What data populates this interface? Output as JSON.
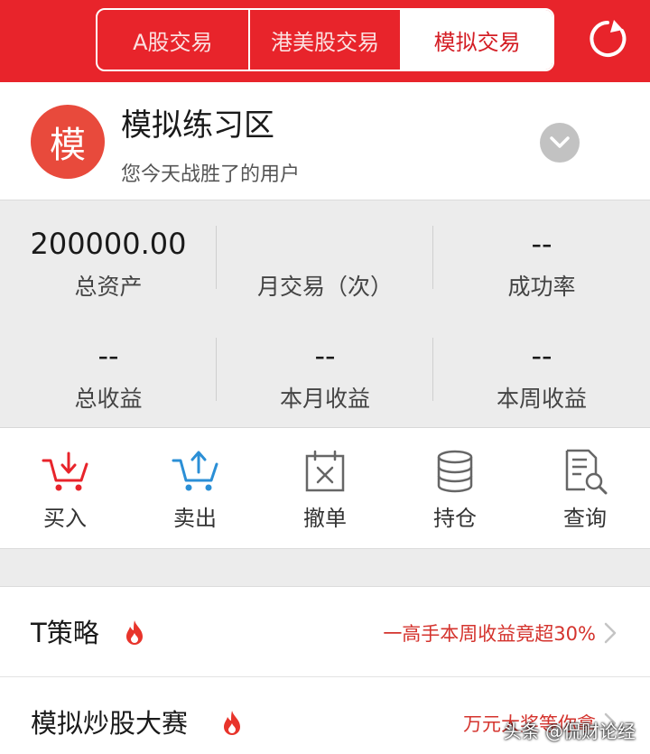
{
  "header": {
    "tabs": [
      {
        "label": "A股交易",
        "active": false
      },
      {
        "label": "港美股交易",
        "active": false
      },
      {
        "label": "模拟交易",
        "active": true
      }
    ],
    "refresh_icon": "refresh-icon"
  },
  "profile": {
    "avatar_text": "模",
    "title": "模拟练习区",
    "subtitle": "您今天战胜了的用户",
    "expand_icon": "chevron-down-icon"
  },
  "stats": {
    "total_assets": {
      "value": "200000.00",
      "label": "总资产"
    },
    "monthly_trades": {
      "value": "",
      "label": "月交易（次）"
    },
    "success_rate": {
      "value": "--",
      "label": "成功率"
    },
    "total_profit": {
      "value": "--",
      "label": "总收益"
    },
    "month_profit": {
      "value": "--",
      "label": "本月收益"
    },
    "week_profit": {
      "value": "--",
      "label": "本周收益"
    }
  },
  "actions": [
    {
      "label": "买入",
      "icon": "cart-in-icon"
    },
    {
      "label": "卖出",
      "icon": "cart-out-icon"
    },
    {
      "label": "撤单",
      "icon": "cancel-calendar-icon"
    },
    {
      "label": "持仓",
      "icon": "database-stack-icon"
    },
    {
      "label": "查询",
      "icon": "document-search-icon"
    }
  ],
  "list": [
    {
      "name": "T策略",
      "desc": "一高手本周收益竟超30%",
      "icon": "fire-icon"
    },
    {
      "name": "模拟炒股大赛",
      "desc": "万元大奖等你拿",
      "icon": "fire-icon"
    }
  ],
  "watermark": "头条 @侃财论经",
  "colors": {
    "brand_red": "#e8242b",
    "accent_red": "#d4332d",
    "buy_red": "#e8242b",
    "sell_blue": "#2b8fd6"
  }
}
